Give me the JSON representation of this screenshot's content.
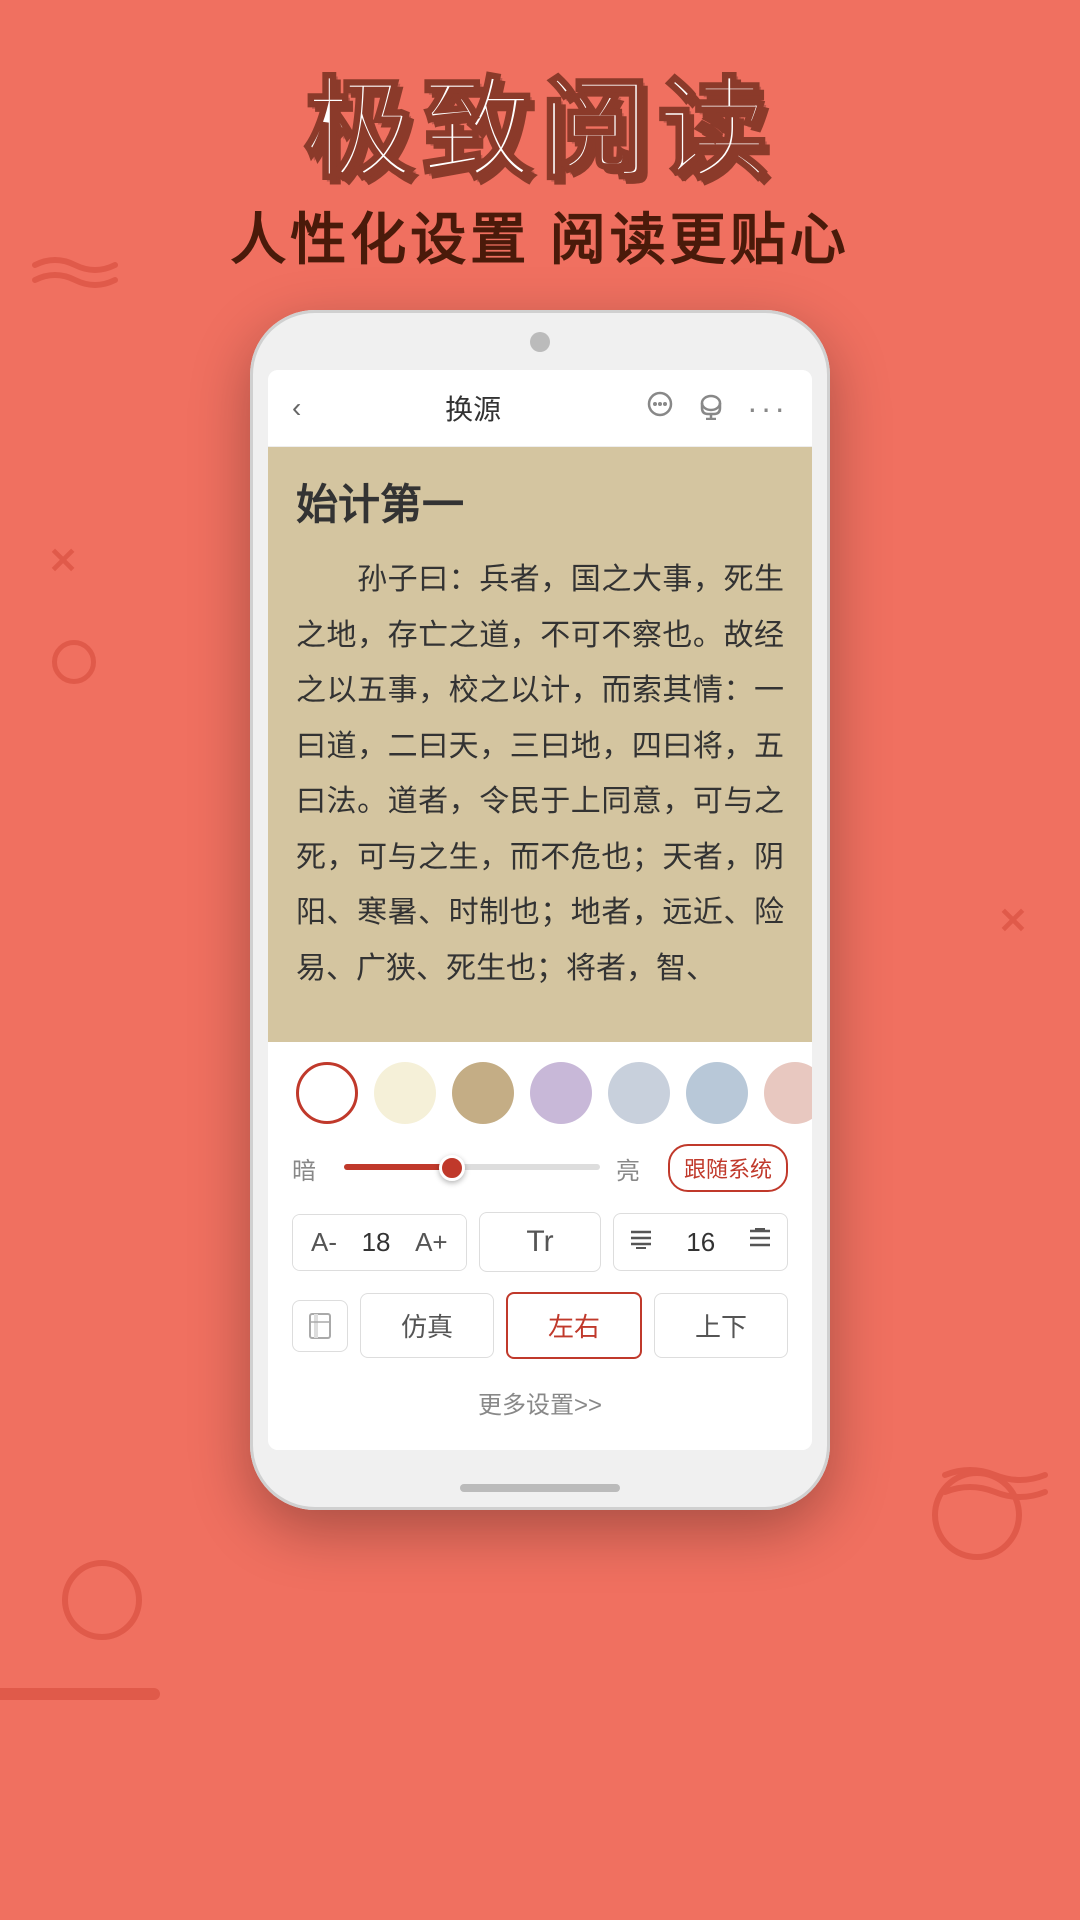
{
  "header": {
    "title": "极致阅读",
    "subtitle": "人性化设置  阅读更贴心"
  },
  "topbar": {
    "back_label": "‹",
    "title": "换源",
    "comment_icon": "💬",
    "audio_icon": "🎧",
    "more_icon": "···"
  },
  "reading": {
    "chapter_title": "始计第一",
    "content": "　　孙子曰：兵者，国之大事，死生之地，存亡之道，不可不察也。故经之以五事，校之以计，而索其情：一曰道，二曰天，三曰地，四曰将，五曰法。道者，令民于上同意，可与之死，可与之生，而不危也；天者，阴阳、寒暑、时制也；地者，远近、险易、广狭、死生也；将者，智、"
  },
  "settings": {
    "colors": [
      {
        "id": "white",
        "hex": "#FFFFFF",
        "selected": true
      },
      {
        "id": "cream",
        "hex": "#F5F0D8",
        "selected": false
      },
      {
        "id": "tan",
        "hex": "#C4AD85",
        "selected": false
      },
      {
        "id": "lavender",
        "hex": "#C8B8D8",
        "selected": false
      },
      {
        "id": "light-blue-gray",
        "hex": "#C8D0DC",
        "selected": false
      },
      {
        "id": "light-blue",
        "hex": "#B8C8D8",
        "selected": false
      },
      {
        "id": "pink",
        "hex": "#E8C8C0",
        "selected": false
      }
    ],
    "brightness": {
      "dark_label": "暗",
      "light_label": "亮",
      "system_btn": "跟随系统",
      "value": 42
    },
    "font": {
      "decrease_label": "A-",
      "size_value": "18",
      "increase_label": "A+",
      "style_icon": "Tr",
      "line_spacing_value": "16"
    },
    "page_modes": [
      {
        "id": "scroll",
        "label": "仿真",
        "active": false
      },
      {
        "id": "horizontal",
        "label": "左右",
        "active": true
      },
      {
        "id": "vertical",
        "label": "上下",
        "active": false
      }
    ],
    "more_label": "更多设置>>"
  }
}
